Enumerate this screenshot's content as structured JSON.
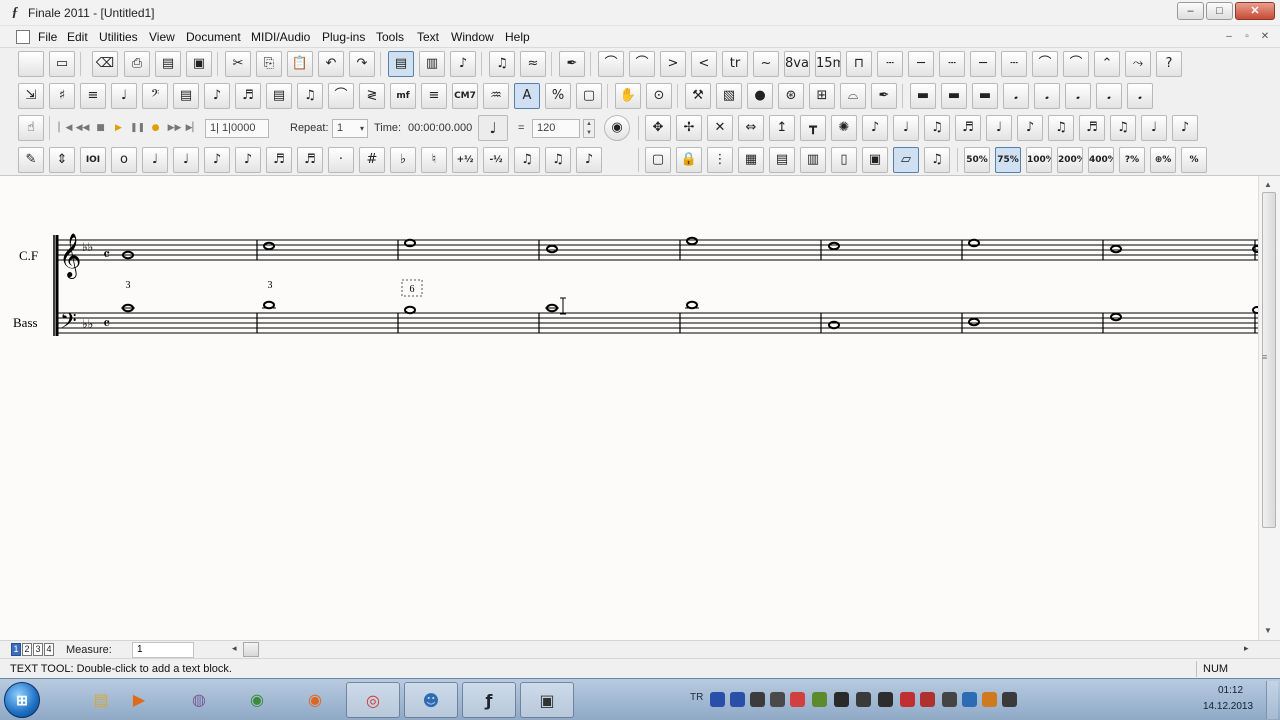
{
  "window": {
    "title": "Finale 2011 - [Untitled1]",
    "controls": {
      "minimize": "–",
      "maximize": "□",
      "close": "✕"
    }
  },
  "menu": {
    "items": [
      "File",
      "Edit",
      "Utilities",
      "View",
      "Document",
      "MIDI/Audio",
      "Plug-ins",
      "Tools",
      "Text",
      "Window",
      "Help"
    ],
    "mdi_controls": [
      "–",
      "▫",
      "✕"
    ]
  },
  "toolbar": {
    "row1": [
      "",
      "▭",
      "⌫",
      "⎙",
      "▤",
      "▣",
      "✂",
      "⎘",
      "📋",
      "↶",
      "↷",
      "▤",
      "▥",
      "♪",
      "♫",
      "≈",
      "✒",
      "⌒",
      "⌒",
      ">",
      "<",
      "tr",
      "~",
      "8va",
      "15ma",
      "⊓",
      "┄",
      "─",
      "┄",
      "─",
      "┄",
      "⌒",
      "⌒",
      "⌃",
      "⤳",
      "?"
    ],
    "row2": [
      "⇲",
      "♯",
      "≡",
      "♩",
      "𝄢",
      "▤",
      "♪",
      "♬",
      "▤",
      "♫",
      "⌒",
      "≷",
      "mf",
      "≡",
      "CM7",
      "♒",
      "A",
      "%",
      "▢",
      "✋",
      "⊙",
      "⚒",
      "▧",
      "●",
      "⊛",
      "⊞",
      "⌓",
      "✒",
      "▬",
      "▬",
      "▬",
      "𝅘",
      "𝅘",
      "𝅘",
      "𝅘",
      "𝅘"
    ],
    "row3": {
      "transport": [
        "▏◀",
        "◀◀",
        "■",
        "▶",
        "❚❚",
        "●",
        "▶▶",
        "▶▏"
      ],
      "position": "1| 1|0000",
      "repeat_label": "Repeat:",
      "repeat_value": "1",
      "time_label": "Time:",
      "time_value": "00:00:00.000",
      "tempo_equals": "=",
      "tempo_value": "120",
      "tool_icons": [
        "✥",
        "✢",
        "✕",
        "⇔",
        "↥",
        "┳",
        "✺",
        "♪",
        "♩",
        "♫",
        "♬",
        "♩",
        "♪",
        "♫",
        "♬",
        "♫",
        "♩",
        "♪",
        "♬"
      ]
    },
    "row4": {
      "entry": [
        "✎",
        "⇕",
        "IOI",
        "o",
        "♩",
        "♩",
        "♪",
        "♪",
        "♬",
        "♬",
        "·",
        "#",
        "♭",
        "♮",
        "+½",
        "-½",
        "♫",
        "♫",
        "♪"
      ],
      "views": [
        "▢",
        "🔒",
        "⋮",
        "▦",
        "▤",
        "▥",
        "▯",
        "▣",
        "▱",
        "♫"
      ],
      "zoom": [
        "50%",
        "75%",
        "100%",
        "200%",
        "400%",
        "?%",
        "⊕%",
        "%"
      ]
    }
  },
  "score": {
    "staves": [
      {
        "name": "C.F",
        "clef": "𝄞",
        "key": "♭♭",
        "time": "𝄴"
      },
      {
        "name": "Bass",
        "clef": "𝄢",
        "key": "♭♭",
        "time": "𝄴"
      }
    ],
    "figures": [
      "3",
      "3",
      "6"
    ]
  },
  "bottom": {
    "layers": [
      "1",
      "2",
      "3",
      "4"
    ],
    "measure_label": "Measure:",
    "measure_value": "1",
    "arrow_left": "◂",
    "arrow_right": "▸"
  },
  "status": {
    "text": "TEXT TOOL: Double-click to add a text block.",
    "num": "NUM"
  },
  "taskbar": {
    "start": "⊞",
    "apps": [
      {
        "name": "explorer",
        "glyph": "▤",
        "color": "#d9a733"
      },
      {
        "name": "media-player",
        "glyph": "▶",
        "color": "#e06a1a"
      },
      {
        "name": "onion",
        "glyph": "◍",
        "color": "#7a5a9a"
      },
      {
        "name": "globe",
        "glyph": "◉",
        "color": "#3c8a3c"
      },
      {
        "name": "firefox",
        "glyph": "◉",
        "color": "#e2651e"
      },
      {
        "name": "chrome",
        "glyph": "◎",
        "color": "#d4372c"
      },
      {
        "name": "messenger",
        "glyph": "☻",
        "color": "#2d6bb5"
      },
      {
        "name": "finale",
        "glyph": "ƒ",
        "color": "#1e2430"
      },
      {
        "name": "window",
        "glyph": "▣",
        "color": "#333"
      }
    ],
    "tray_lang": "TR",
    "tray_colors": [
      "#2a4fa8",
      "#2a4fa8",
      "#3c3c3c",
      "#4a4a4a",
      "#d04040",
      "#5c8a2c",
      "#2a2a2a",
      "#3a3a3a",
      "#2d2d2d",
      "#c03030",
      "#b03030",
      "#444",
      "#2d6bb5",
      "#d07a20",
      "#3a3a3a"
    ],
    "time": "01:12",
    "date": "14.12.2013"
  }
}
